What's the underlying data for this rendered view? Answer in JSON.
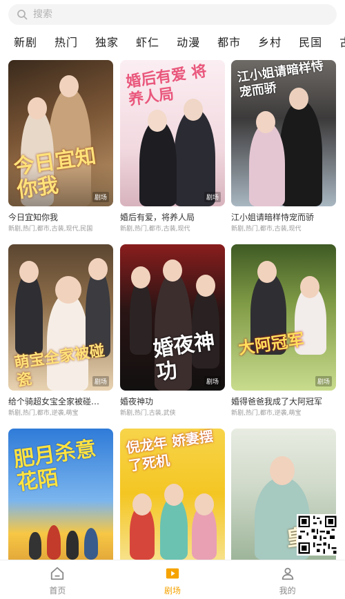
{
  "search": {
    "placeholder": "搜索",
    "icon": "search-icon"
  },
  "tabs": [
    "新剧",
    "热门",
    "独家",
    "虾仁",
    "动漫",
    "都市",
    "乡村",
    "民国",
    "古装"
  ],
  "cards": [
    {
      "title": "今日宜知你我",
      "tags": "新剧,热门,都市,古装,现代,民国",
      "poster_text": "今日宜知你我",
      "badge": "剧场",
      "theme": [
        "#6b4a2e",
        "#c39b6d"
      ]
    },
    {
      "title": "婚后有爱，将养人局",
      "tags": "新剧,热门,都市,古装,现代",
      "poster_text": "婚后有爱 将养人局",
      "badge": "剧场",
      "theme": [
        "#f4dfe6",
        "#cfa3b0"
      ]
    },
    {
      "title": "江小姐请暗样恃宠而骄",
      "tags": "新剧,热门,都市,古装,现代",
      "poster_text": "江小姐请暗样恃宠而骄",
      "badge": "",
      "theme": [
        "#3c3a3a",
        "#a9b7c2"
      ]
    },
    {
      "title": "给个骑超女宝全家被碰…",
      "tags": "新剧,热门,都市,逆袭,萌宝",
      "poster_text": "萌宝全家被碰瓷",
      "badge": "剧场",
      "theme": [
        "#7a5c3b",
        "#e8d3b2"
      ]
    },
    {
      "title": "婚夜神功",
      "tags": "新剧,热门,古装,武侠",
      "poster_text": "婚夜神功",
      "badge": "剧场",
      "theme": [
        "#1f1a1a",
        "#8a1d1d"
      ]
    },
    {
      "title": "婚得爸爸我成了大阿冠军",
      "tags": "新剧,热门,都市,逆袭,萌宝",
      "poster_text": "大阿冠军",
      "badge": "剧场",
      "theme": [
        "#5f7a35",
        "#c9dc8e"
      ]
    },
    {
      "title": "",
      "tags": "",
      "poster_text": "肥月杀意花陌",
      "badge": "",
      "theme": [
        "#2f7bd8",
        "#f7c744"
      ]
    },
    {
      "title": "",
      "tags": "",
      "poster_text": "倪龙年 娇妻摆了死机",
      "badge": "",
      "theme": [
        "#f4c623",
        "#f7e18a"
      ]
    },
    {
      "title": "",
      "tags": "",
      "poster_text": "皇",
      "badge": "",
      "theme": [
        "#cfd9c9",
        "#9eb59a"
      ]
    }
  ],
  "bottom_nav": [
    {
      "label": "首页",
      "icon": "home-icon",
      "active": false
    },
    {
      "label": "剧场",
      "icon": "play-icon",
      "active": true
    },
    {
      "label": "我的",
      "icon": "user-icon",
      "active": false
    }
  ],
  "colors": {
    "accent": "#f5a300",
    "inactive": "#8a8a8a",
    "text": "#333333",
    "subtext": "#9a9a9a"
  }
}
